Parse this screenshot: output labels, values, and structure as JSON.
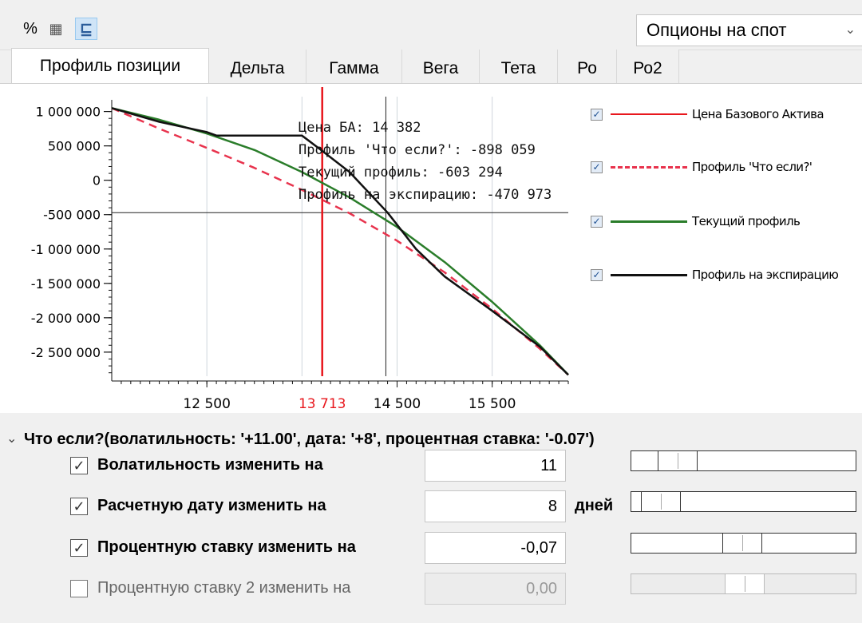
{
  "toolbar": {
    "buttons": [
      {
        "name": "percent-icon",
        "glyph": "%"
      },
      {
        "name": "grid-icon",
        "glyph": "▦"
      },
      {
        "name": "tree-icon",
        "glyph": "⊑"
      }
    ],
    "mode_select": {
      "value": "Опционы на спот"
    }
  },
  "tabs": [
    "Профиль позиции",
    "Дельта",
    "Гамма",
    "Вега",
    "Тета",
    "Ро",
    "Ро2"
  ],
  "active_tab": 0,
  "chart_data": {
    "type": "line",
    "ylim": [
      -2850000,
      1100000
    ],
    "xlim": [
      11500,
      16300
    ],
    "yticks": [
      {
        "v": 1000000,
        "label": "1 000 000"
      },
      {
        "v": 500000,
        "label": "500 000"
      },
      {
        "v": 0,
        "label": "0"
      },
      {
        "v": -500000,
        "label": "-500 000"
      },
      {
        "v": -1000000,
        "label": "-1 000 000"
      },
      {
        "v": -1500000,
        "label": "-1 500 000"
      },
      {
        "v": -2000000,
        "label": "-2 000 000"
      },
      {
        "v": -2500000,
        "label": "-2 500 000"
      }
    ],
    "xticks": [
      {
        "v": 12500,
        "label": "12 500"
      },
      {
        "v": 14500,
        "label": "14 500"
      },
      {
        "v": 15500,
        "label": "15 500"
      }
    ],
    "current_price": {
      "v": 13713,
      "label": "13 713"
    },
    "x_gridlines": [
      12500,
      13500,
      14500,
      15500
    ],
    "crosshair": {
      "x": 14382,
      "y": -470973
    },
    "tooltip": [
      "Цена БА: 14 382",
      "Профиль 'Что если?': -898 059",
      "Текущий профиль: -603 294",
      "Профиль на экспирацию: -470 973"
    ],
    "series": [
      {
        "name": "Цена Базового Актива",
        "color": "#e8171d",
        "style": "solid",
        "checked": true
      },
      {
        "name": "Профиль 'Что если?'",
        "color": "#e8334d",
        "style": "dashed",
        "checked": true,
        "x": [
          11500,
          12000,
          12500,
          13000,
          13500,
          14000,
          14500,
          15000,
          15500,
          16000,
          16300
        ],
        "y": [
          1050000,
          750000,
          470000,
          180000,
          -140000,
          -480000,
          -880000,
          -1340000,
          -1870000,
          -2450000,
          -2830000
        ]
      },
      {
        "name": "Текущий профиль",
        "color": "#2a7d2a",
        "style": "solid",
        "checked": true,
        "x": [
          11500,
          12000,
          12500,
          13000,
          13500,
          14000,
          14500,
          15000,
          15500,
          16000,
          16300
        ],
        "y": [
          1050000,
          880000,
          680000,
          440000,
          120000,
          -250000,
          -680000,
          -1190000,
          -1770000,
          -2400000,
          -2830000
        ]
      },
      {
        "name": "Профиль на экспирацию",
        "color": "#111111",
        "style": "solid",
        "checked": true,
        "x": [
          11500,
          12000,
          12500,
          12600,
          13000,
          13500,
          13700,
          14000,
          14400,
          14700,
          15000,
          15500,
          16000,
          16300
        ],
        "y": [
          1050000,
          850000,
          700000,
          650000,
          650000,
          650000,
          440000,
          120000,
          -470973,
          -1000000,
          -1400000,
          -1900000,
          -2420000,
          -2830000
        ]
      }
    ]
  },
  "whatif": {
    "title": "Что если?(волатильность: '+11.00', дата: '+8', процентная ставка: '-0.07')",
    "rows": [
      {
        "label": "Волатильность изменить на",
        "value": "11",
        "checked": true,
        "enabled": true,
        "unit": "",
        "slider": 0.14
      },
      {
        "label": "Расчетную дату изменить на",
        "value": "8",
        "checked": true,
        "enabled": true,
        "unit": "дней",
        "slider": 0.05
      },
      {
        "label": "Процентную ставку изменить на",
        "value": "-0,07",
        "checked": true,
        "enabled": true,
        "unit": "",
        "slider": 0.49
      },
      {
        "label": "Процентную ставку 2 изменить на",
        "value": "0,00",
        "checked": false,
        "enabled": false,
        "unit": "",
        "slider": 0.5
      }
    ]
  }
}
